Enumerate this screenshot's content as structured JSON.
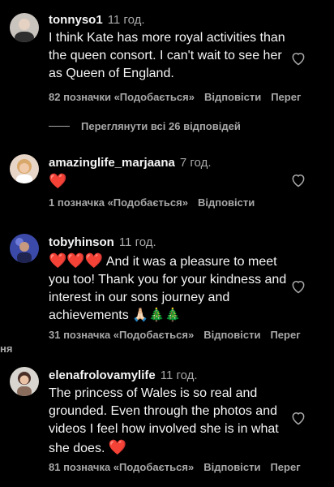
{
  "comments": [
    {
      "username": "tonnyso1",
      "time": "11 год.",
      "text": "I think Kate has more royal activities than the queen consort. I can't wait to see her as Queen of England.",
      "likes": "82 позначки «Подобається»",
      "reply": "Відповісти",
      "more": "Перег"
    },
    {
      "username": "amazinglife_marjaana",
      "time": "7 год.",
      "emoji": "❤️",
      "likes": "1 позначка «Подобається»",
      "reply": "Відповісти"
    },
    {
      "username": "tobyhinson",
      "time": "11 год.",
      "emoji_prefix": "❤️❤️❤️",
      "text": "And it was a pleasure to meet you too! Thank you for your kindness and interest in our sons journey and achievements",
      "emoji_suffix": "🙏🏻🎄🎄",
      "likes": "31 позначка «Подобається»",
      "reply": "Відповісти",
      "more": "Перег"
    },
    {
      "username": "elenafrolovamylife",
      "time": "11 год.",
      "text": "The princess of Wales is so real and grounded. Even through the photos and videos I feel how involved she is in what she does.",
      "emoji_suffix": "❤️",
      "likes": "81 позначка «Подобається»",
      "reply": "Відповісти",
      "more": "Перег"
    }
  ],
  "view_replies": "Переглянути всі 26 відповідей",
  "cut_fragment": "ня",
  "colors": {
    "background": "#000000",
    "text": "#f5f5f5",
    "secondary": "#a8a8a8",
    "heart": "#ed4956"
  },
  "icons": {
    "like": "heart-outline-icon"
  }
}
